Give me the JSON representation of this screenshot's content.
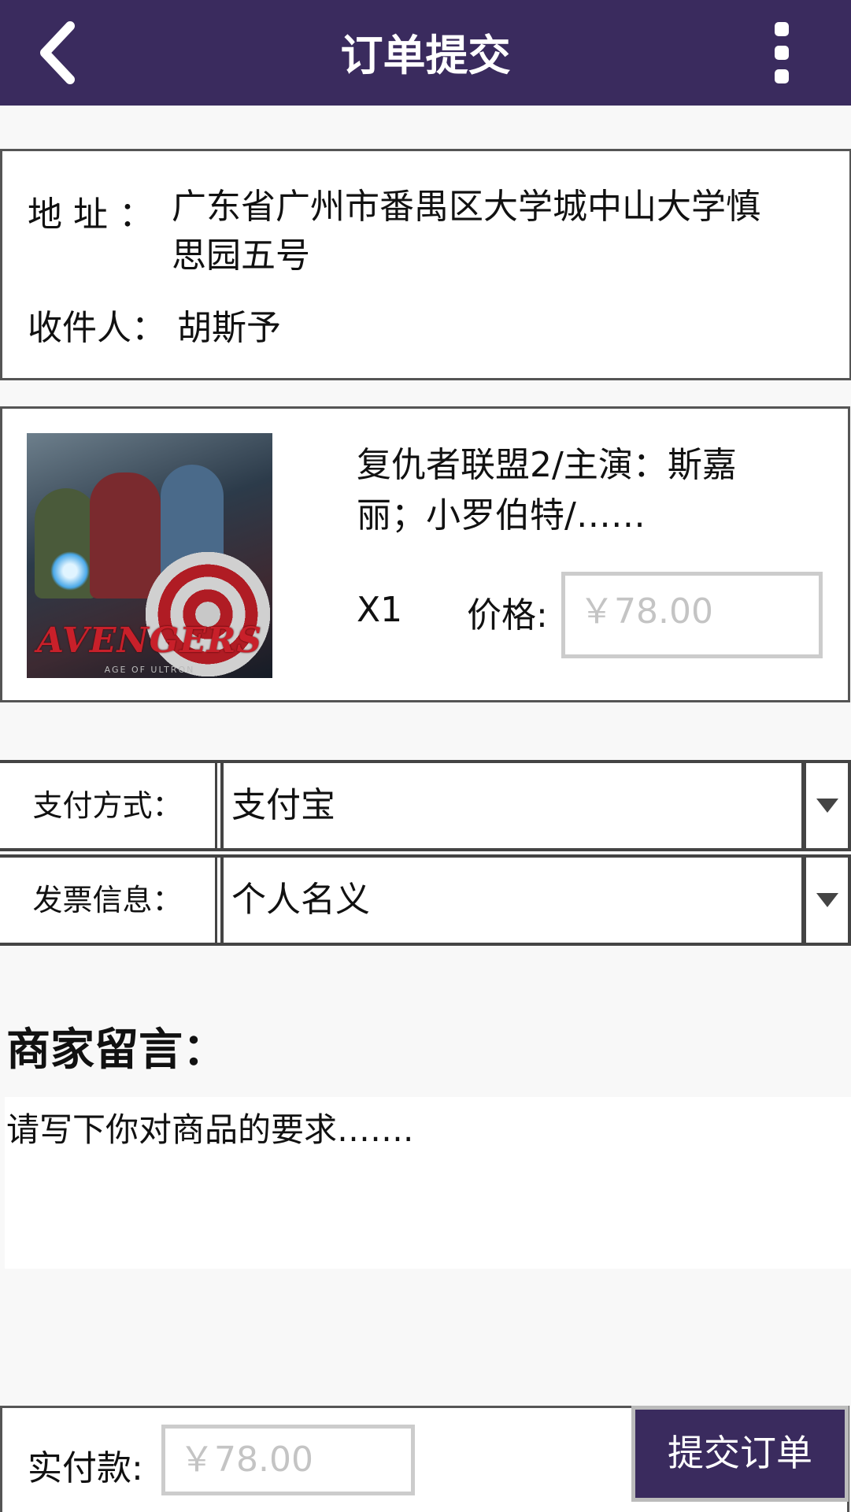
{
  "header": {
    "title": "订单提交",
    "back_icon": "chevron-left-icon",
    "more_icon": "more-vertical-icon",
    "bar_color": "#3a2b5e"
  },
  "address": {
    "address_label": "地  址 ：",
    "address_value": "广东省广州市番禺区大学城中山大学慎思园五号",
    "recipient_label": "收件人：",
    "recipient_value": "胡斯予"
  },
  "product": {
    "title": "复仇者联盟2/主演：斯嘉丽；小罗伯特/……",
    "image_logo_text": "AVENGERS",
    "image_sub_text": "AGE OF ULTRON",
    "quantity": "X1",
    "price_label": "价格:",
    "price_value": "￥78.00"
  },
  "payment": {
    "label": "支付方式：",
    "value": "支付宝"
  },
  "invoice": {
    "label": "发票信息：",
    "value": "个人名义"
  },
  "message": {
    "heading": "商家留言：",
    "placeholder": "请写下你对商品的要求……."
  },
  "footer": {
    "total_label": "实付款:",
    "total_value": "￥78.00",
    "submit_label": "提交订单"
  }
}
